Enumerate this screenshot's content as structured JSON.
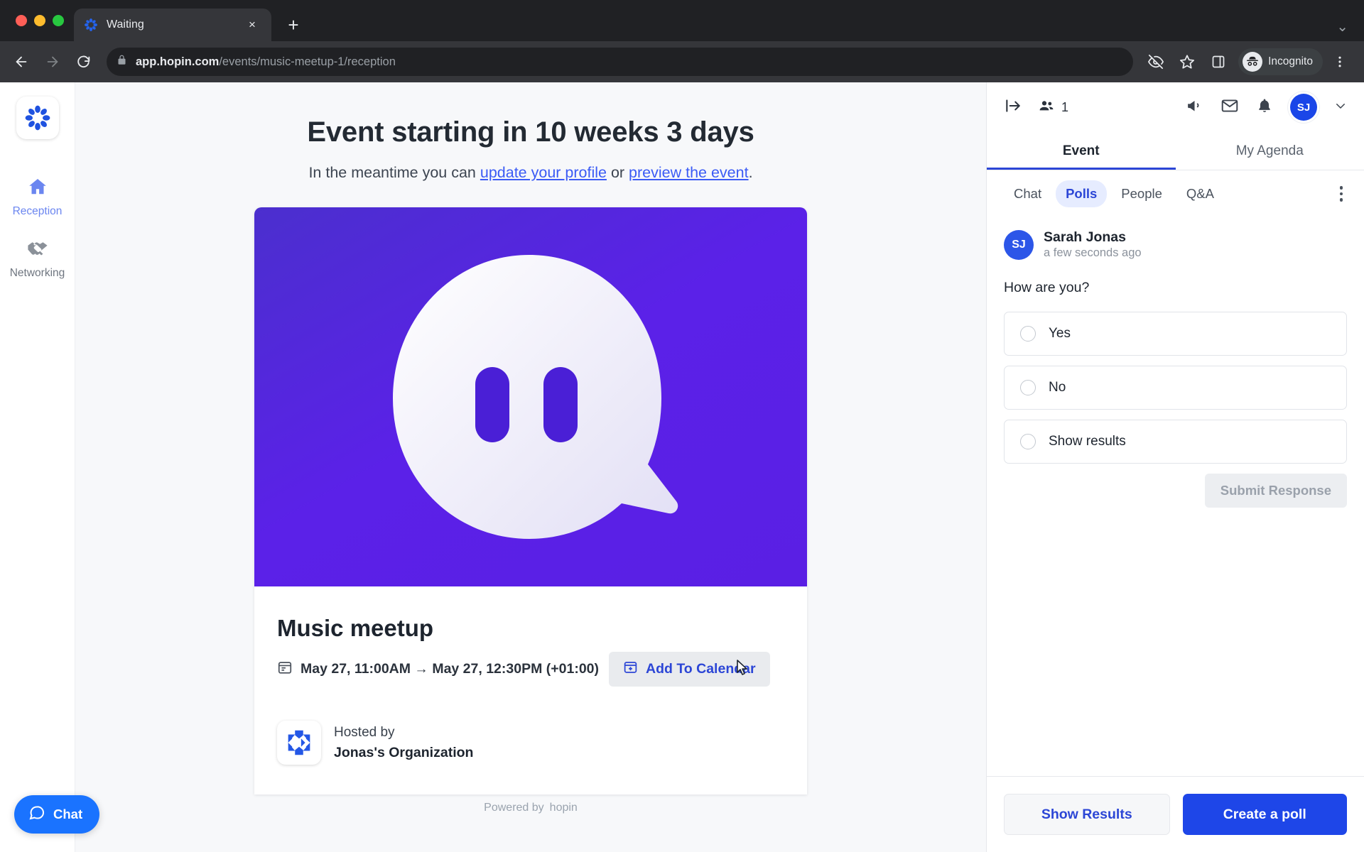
{
  "browser": {
    "tab": {
      "title": "Waiting",
      "favicon": "hopin-logo-icon",
      "close": "×"
    },
    "new_tab": "+",
    "window_chevron": "⌄",
    "back": "←",
    "forward": "→",
    "reload": "⟳",
    "url_host": "app.hopin.com",
    "url_path": "/events/music-meetup-1/reception",
    "incognito_label": "Incognito",
    "icons": [
      "eye-off-icon",
      "star-icon",
      "side-panel-icon",
      "incognito-icon",
      "kebab-menu-icon"
    ]
  },
  "sidebar": {
    "logo": "hopin-logo-icon",
    "items": [
      {
        "label": "Reception",
        "icon": "home-icon",
        "active": true
      },
      {
        "label": "Networking",
        "icon": "handshake-icon",
        "active": false
      }
    ],
    "chat_widget": {
      "label": "Chat",
      "icon": "chat-bubble-icon"
    }
  },
  "main": {
    "headline": "Event starting in 10 weeks 3 days",
    "subline_prefix": "In the meantime you can ",
    "link_profile": "update your profile",
    "subline_or": " or ",
    "link_preview": "preview the event",
    "subline_suffix": ".",
    "card": {
      "banner_icon": "ghost-mascot-image",
      "title": "Music meetup",
      "date_icon": "calendar-icon",
      "date_text": "May 27, 11:00AM → May 27, 12:30PM (+01:00)",
      "add_to_calendar": "Add To Calendar",
      "add_to_calendar_icon": "calendar-plus-icon",
      "host_logo": "organization-logo-icon",
      "hosted_by_label": "Hosted by",
      "host_name": "Jonas's Organization",
      "powered_by": "Powered by",
      "powered_brand": "hopin"
    }
  },
  "panel": {
    "header": {
      "collapse_icon": "collapse-panel-icon",
      "people_icon": "people-icon",
      "people_count": "1",
      "announce_icon": "megaphone-icon",
      "mail_icon": "envelope-icon",
      "bell_icon": "bell-icon",
      "avatar_initials": "SJ",
      "chevron_icon": "chevron-down-icon"
    },
    "tabs": [
      {
        "label": "Event",
        "active": true
      },
      {
        "label": "My Agenda",
        "active": false
      }
    ],
    "subtabs": [
      {
        "label": "Chat",
        "active": false
      },
      {
        "label": "Polls",
        "active": true
      },
      {
        "label": "People",
        "active": false
      },
      {
        "label": "Q&A",
        "active": false
      }
    ],
    "kebab_icon": "kebab-menu-icon",
    "poll": {
      "author_initials": "SJ",
      "author_name": "Sarah Jonas",
      "timestamp": "a few seconds ago",
      "question": "How are you?",
      "options": [
        {
          "label": "Yes",
          "selected": false
        },
        {
          "label": "No",
          "selected": false
        },
        {
          "label": "Show results",
          "selected": false
        }
      ],
      "submit_label": "Submit Response",
      "submit_disabled": true
    },
    "footer": {
      "show_results": "Show Results",
      "create_poll": "Create a poll"
    }
  },
  "colors": {
    "brand_blue": "#1e46e8",
    "link_blue": "#3b5bf5",
    "banner_purple": "#5b21e8",
    "chrome_dark": "#202124"
  }
}
